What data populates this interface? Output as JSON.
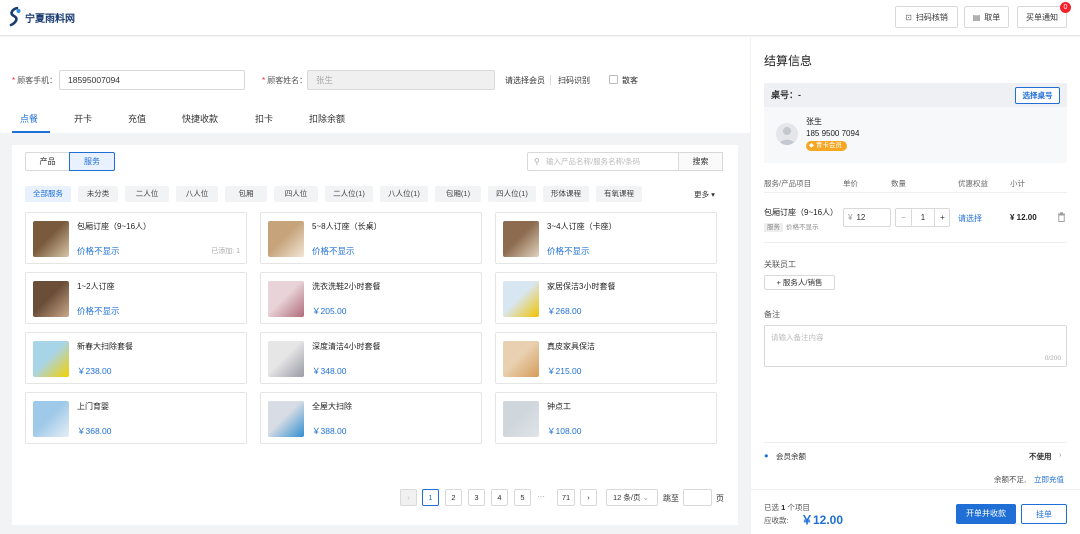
{
  "app": {
    "logo_text": "宁夏雨料网"
  },
  "topbar": {
    "scan_verify": "扫码核销",
    "take_order": "取单",
    "purchase_notice": "买单通知",
    "notice_count": "0"
  },
  "form": {
    "phone_label": "顾客手机：",
    "phone_value": "18595007094",
    "name_label": "顾客姓名：",
    "name_value": "张生",
    "select_member": "请选择会员",
    "scan_recognize": "扫码识别",
    "walk_in": "散客"
  },
  "tabs": [
    "点餐",
    "开卡",
    "充值",
    "快捷收款",
    "扣卡",
    "扣除余额"
  ],
  "segments": {
    "product": "产品",
    "service": "服务"
  },
  "search": {
    "placeholder": "输入产品名称/服务名称/条码",
    "button": "搜索"
  },
  "categories": [
    "全部服务",
    "未分类",
    "二人位",
    "八人位",
    "包厢",
    "四人位",
    "二人位(1)",
    "八人位(1)",
    "包厢(1)",
    "四人位(1)",
    "形体课程",
    "有氧课程"
  ],
  "more": "更多",
  "cards": [
    {
      "name": "包厢订座（9~16人）",
      "price": "价格不显示",
      "added": "已添加: 1"
    },
    {
      "name": "5~8人订座（长桌）",
      "price": "价格不显示",
      "added": ""
    },
    {
      "name": "3~4人订座（卡座）",
      "price": "价格不显示",
      "added": ""
    },
    {
      "name": "1~2人订座",
      "price": "价格不显示",
      "added": ""
    },
    {
      "name": "洗衣洗鞋2小时套餐",
      "price": "￥205.00",
      "added": ""
    },
    {
      "name": "家居保洁3小时套餐",
      "price": "￥268.00",
      "added": ""
    },
    {
      "name": "新春大扫除套餐",
      "price": "￥238.00",
      "added": ""
    },
    {
      "name": "深度清洁4小时套餐",
      "price": "￥348.00",
      "added": ""
    },
    {
      "name": "真皮家具保洁",
      "price": "￥215.00",
      "added": ""
    },
    {
      "name": "上门育婴",
      "price": "￥368.00",
      "added": ""
    },
    {
      "name": "全屋大扫除",
      "price": "￥388.00",
      "added": ""
    },
    {
      "name": "钟点工",
      "price": "￥108.00",
      "added": ""
    }
  ],
  "pager": {
    "prev": "‹",
    "next": "›",
    "pages": [
      "1",
      "2",
      "3",
      "4",
      "5"
    ],
    "dots": "···",
    "last": "71",
    "page_size": "12 条/页",
    "jump_label": "跳至",
    "page_unit": "页"
  },
  "settle": {
    "title": "结算信息",
    "table_label": "桌号：-",
    "select_table": "选择桌号",
    "member_name": "张生",
    "member_phone": "185 9500 7094",
    "member_tag": "青卡会员",
    "columns": [
      "服务/产品项目",
      "单价",
      "数量",
      "优惠权益",
      "小计"
    ],
    "item": {
      "name": "包厢订座（9~16人）",
      "type_tag": "服务",
      "price_note": "价格不显示",
      "currency": "¥",
      "unit_price": "12",
      "quantity": "1",
      "benefit": "请选择",
      "subtotal": "¥ 12.00"
    },
    "staff_label": "关联员工",
    "staff_button": "+ 服务人/销售",
    "remark_label": "备注",
    "remark_placeholder": "请输入备注内容",
    "remark_count": "0/200",
    "balance_label": "会员余额",
    "balance_status": "不使用",
    "insufficient": "余额不足,",
    "recharge_now": "立即充值",
    "selected_prefix": "已选",
    "selected_count": "1",
    "selected_suffix": "个项目",
    "receivable_label": "应收款:",
    "receivable_amount": "￥12.00",
    "checkout_button": "开单并收款",
    "hold_button": "挂单"
  },
  "colors": {
    "accent": "#1f6fd6",
    "badge": "#f5222d",
    "member_tag": "#f5a623"
  }
}
